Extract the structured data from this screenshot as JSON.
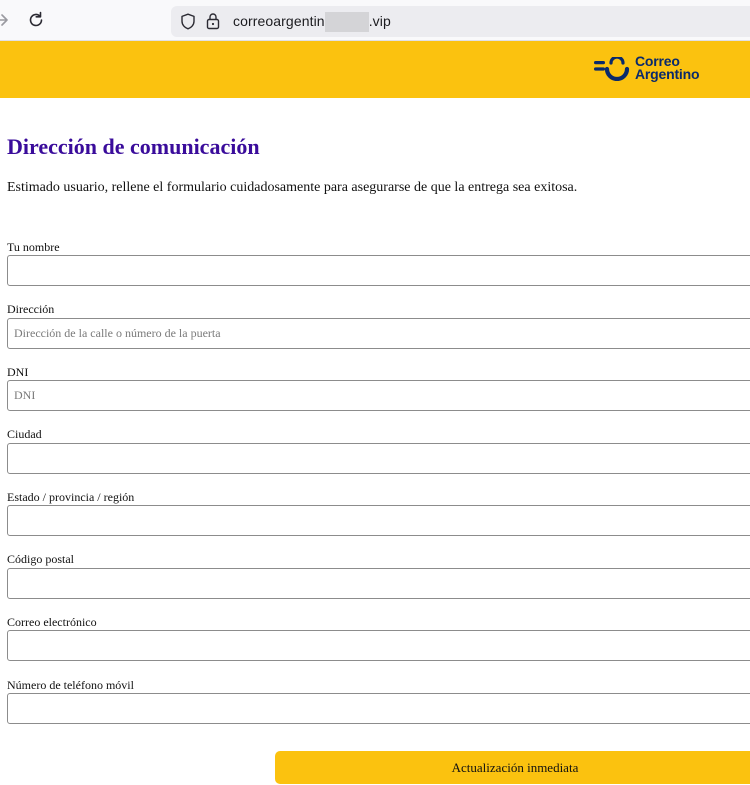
{
  "browser": {
    "url_prefix": "correoargentin",
    "url_suffix": ".vip",
    "icons": {
      "forward": "arrow-right-icon",
      "reload": "reload-icon",
      "shield": "shield-icon",
      "lock": "lock-icon"
    }
  },
  "header": {
    "brand_line1": "Correo",
    "brand_line2": "Argentino",
    "colors": {
      "background": "#fbc20f",
      "brand": "#0a2a6b"
    }
  },
  "main": {
    "title": "Dirección de comunicación",
    "intro": "Estimado usuario, rellene el formulario cuidadosamente para asegurarse de que la entrega sea exitosa.",
    "title_color": "#3a0c9b"
  },
  "form": {
    "fields": [
      {
        "label": "Tu nombre",
        "placeholder": "",
        "value": ""
      },
      {
        "label": "Dirección",
        "placeholder": "Dirección de la calle o número de la puerta",
        "value": ""
      },
      {
        "label": "DNI",
        "placeholder": "DNI",
        "value": ""
      },
      {
        "label": "Ciudad",
        "placeholder": "",
        "value": ""
      },
      {
        "label": "Estado / provincia / región",
        "placeholder": "",
        "value": ""
      },
      {
        "label": "Código postal",
        "placeholder": "",
        "value": ""
      },
      {
        "label": "Correo electrónico",
        "placeholder": "",
        "value": ""
      },
      {
        "label": "Número de teléfono móvil",
        "placeholder": "",
        "value": ""
      }
    ],
    "submit_label": "Actualización inmediata",
    "submit_color": "#fbc20f"
  }
}
